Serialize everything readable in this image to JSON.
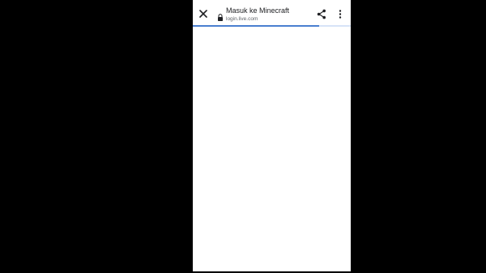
{
  "browser": {
    "title": "Masuk ke Minecraft",
    "url": "login.live.com",
    "progress": 0.8
  },
  "icons": {
    "close": "close-icon",
    "lock": "lock-icon",
    "share": "share-icon",
    "more": "more-vert-icon"
  },
  "colors": {
    "letterbox": "#000000",
    "progress_fill": "#4a7fd0",
    "progress_track": "#d7e3f7"
  }
}
